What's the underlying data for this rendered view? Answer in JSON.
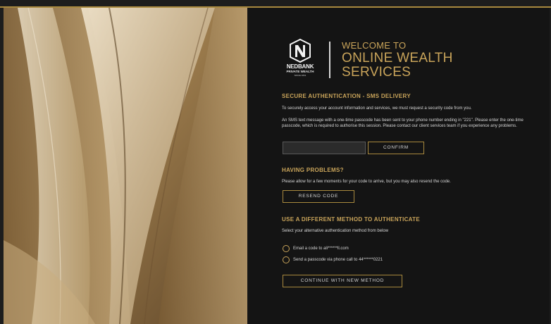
{
  "brand": {
    "logo_name": "NEDBANK",
    "logo_sub": "PRIVATE WEALTH",
    "logo_tag": "SINCE 1831"
  },
  "welcome": {
    "line1": "WELCOME TO",
    "line2": "ONLINE WEALTH",
    "line3": "SERVICES"
  },
  "auth": {
    "heading": "SECURE AUTHENTICATION - SMS DELIVERY",
    "intro": "To securely access your account information and services, we must request a security code from you.",
    "sms_text": "An SMS text message with a one-time passcode has been sent to your phone number ending in \"221\". Please enter the one-time passcode, which is required to authorise this session. Please contact our client services team if you experience any problems.",
    "code_value": "",
    "confirm_label": "CONFIRM"
  },
  "problems": {
    "heading": "HAVING PROBLEMS?",
    "text": "Please allow for a few moments for your code to arrive, but you may also resend the code.",
    "resend_label": "RESEND CODE"
  },
  "alternative": {
    "heading": "USE A DIFFERENT METHOD TO AUTHENTICATE",
    "text": "Select your alternative authentication method from below",
    "options": [
      "Email a code to ali******ll.com",
      "Send a passcode via phone call to 44******0221"
    ],
    "continue_label": "CONTINUE WITH NEW METHOD"
  },
  "colors": {
    "gold": "#c9a45a",
    "panel": "#141414"
  }
}
